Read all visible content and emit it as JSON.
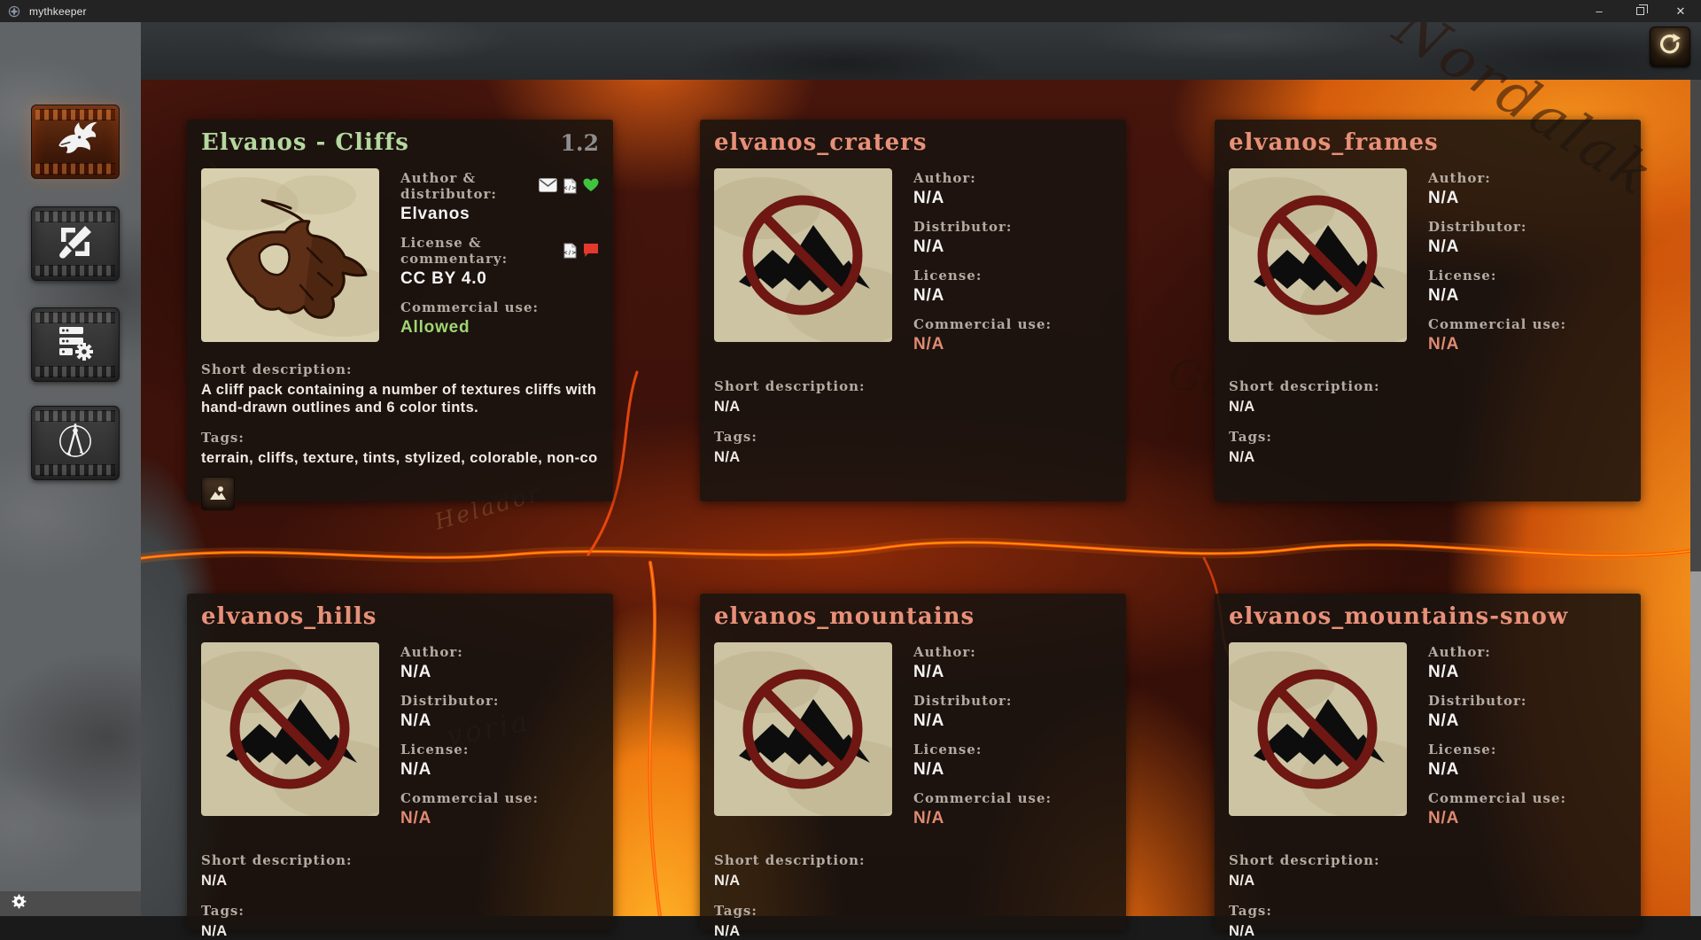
{
  "titlebar": {
    "title": "mythkeeper",
    "app_icon": "dragon-logo-icon",
    "controls": {
      "minimize": "–",
      "restore": "",
      "close": "✕"
    }
  },
  "toolbar": {
    "refresh_icon": "refresh-icon"
  },
  "sidebar": {
    "items": [
      {
        "id": "assets",
        "icon": "dragon-icon",
        "active": true
      },
      {
        "id": "customize",
        "icon": "brush-frame-icon",
        "active": false
      },
      {
        "id": "manage",
        "icon": "server-gear-icon",
        "active": false
      },
      {
        "id": "tools",
        "icon": "compass-icon",
        "active": false
      }
    ],
    "footer_icon": "gear-icon"
  },
  "map": {
    "labels": [
      "Nordalak",
      "Helador",
      "voria",
      "Ga"
    ]
  },
  "theme": {
    "title_green": "#b5d7a0",
    "title_salmon": "#e89078",
    "value_green": "#9fd673",
    "value_salmon": "#e08b72",
    "heart_green": "#3fc43f",
    "comment_red": "#e5392e",
    "version_gray": "#8e8e8e"
  },
  "cards": [
    {
      "title": "Elvanos - Cliffs",
      "title_color": "green",
      "version": "1.2",
      "thumbnail": "cliff-pack-art",
      "fields": [
        {
          "label": "Author & distributor:",
          "value": "Elvanos",
          "value_color": "default",
          "icons": [
            "mail-icon",
            "code-file-icon",
            "heart-icon"
          ]
        },
        {
          "label": "License & commentary:",
          "value": "CC BY 4.0",
          "value_color": "default",
          "icons": [
            "code-file-icon",
            "comment-icon"
          ]
        },
        {
          "label": "Commercial use:",
          "value": "Allowed",
          "value_color": "green",
          "icons": []
        }
      ],
      "short_description_label": "Short description:",
      "short_description": "A cliff pack containing a number of textures cliffs with\nhand-drawn outlines and 6 color tints.",
      "tags_label": "Tags:",
      "tags": "terrain, cliffs, texture, tints, stylized, colorable, non-co…",
      "gallery_button": true
    },
    {
      "title": "elvanos_craters",
      "title_color": "salmon",
      "version": "",
      "thumbnail": "no-image-placeholder",
      "fields": [
        {
          "label": "Author:",
          "value": "N/A",
          "value_color": "default",
          "icons": []
        },
        {
          "label": "Distributor:",
          "value": "N/A",
          "value_color": "default",
          "icons": []
        },
        {
          "label": "License:",
          "value": "N/A",
          "value_color": "default",
          "icons": []
        },
        {
          "label": "Commercial use:",
          "value": "N/A",
          "value_color": "salmon",
          "icons": []
        }
      ],
      "short_description_label": "Short description:",
      "short_description": "N/A",
      "tags_label": "Tags:",
      "tags": "N/A",
      "gallery_button": false
    },
    {
      "title": "elvanos_frames",
      "title_color": "salmon",
      "version": "",
      "thumbnail": "no-image-placeholder",
      "fields": [
        {
          "label": "Author:",
          "value": "N/A",
          "value_color": "default",
          "icons": []
        },
        {
          "label": "Distributor:",
          "value": "N/A",
          "value_color": "default",
          "icons": []
        },
        {
          "label": "License:",
          "value": "N/A",
          "value_color": "default",
          "icons": []
        },
        {
          "label": "Commercial use:",
          "value": "N/A",
          "value_color": "salmon",
          "icons": []
        }
      ],
      "short_description_label": "Short description:",
      "short_description": "N/A",
      "tags_label": "Tags:",
      "tags": "N/A",
      "gallery_button": false
    },
    {
      "title": "elvanos_hills",
      "title_color": "salmon",
      "version": "",
      "thumbnail": "no-image-placeholder",
      "fields": [
        {
          "label": "Author:",
          "value": "N/A",
          "value_color": "default",
          "icons": []
        },
        {
          "label": "Distributor:",
          "value": "N/A",
          "value_color": "default",
          "icons": []
        },
        {
          "label": "License:",
          "value": "N/A",
          "value_color": "default",
          "icons": []
        },
        {
          "label": "Commercial use:",
          "value": "N/A",
          "value_color": "salmon",
          "icons": []
        }
      ],
      "short_description_label": "Short description:",
      "short_description": "N/A",
      "tags_label": "Tags:",
      "tags": "N/A",
      "gallery_button": false
    },
    {
      "title": "elvanos_mountains",
      "title_color": "salmon",
      "version": "",
      "thumbnail": "no-image-placeholder",
      "fields": [
        {
          "label": "Author:",
          "value": "N/A",
          "value_color": "default",
          "icons": []
        },
        {
          "label": "Distributor:",
          "value": "N/A",
          "value_color": "default",
          "icons": []
        },
        {
          "label": "License:",
          "value": "N/A",
          "value_color": "default",
          "icons": []
        },
        {
          "label": "Commercial use:",
          "value": "N/A",
          "value_color": "salmon",
          "icons": []
        }
      ],
      "short_description_label": "Short description:",
      "short_description": "N/A",
      "tags_label": "Tags:",
      "tags": "N/A",
      "gallery_button": false
    },
    {
      "title": "elvanos_mountains-snow",
      "title_color": "salmon",
      "version": "",
      "thumbnail": "no-image-placeholder",
      "fields": [
        {
          "label": "Author:",
          "value": "N/A",
          "value_color": "default",
          "icons": []
        },
        {
          "label": "Distributor:",
          "value": "N/A",
          "value_color": "default",
          "icons": []
        },
        {
          "label": "License:",
          "value": "N/A",
          "value_color": "default",
          "icons": []
        },
        {
          "label": "Commercial use:",
          "value": "N/A",
          "value_color": "salmon",
          "icons": []
        }
      ],
      "short_description_label": "Short description:",
      "short_description": "N/A",
      "tags_label": "Tags:",
      "tags": "N/A",
      "gallery_button": false
    }
  ]
}
